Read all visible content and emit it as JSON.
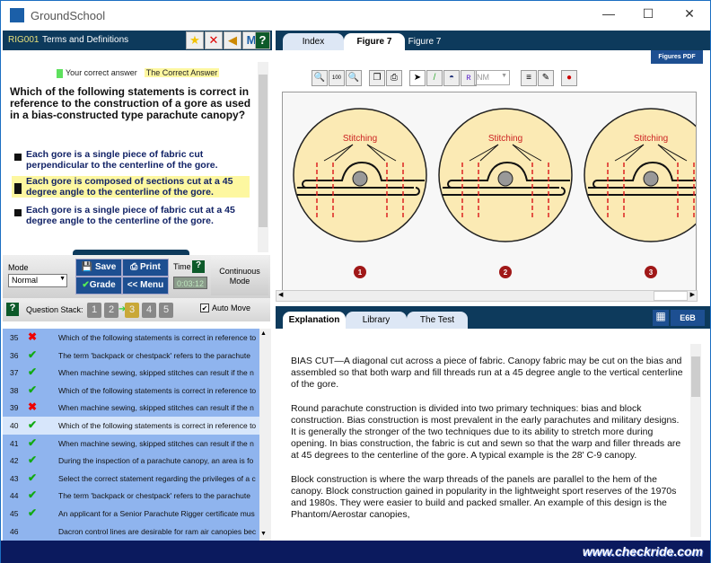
{
  "window": {
    "title": "GroundSchool",
    "minimize": "—",
    "maximize": "☐",
    "close": "✕"
  },
  "question_header": {
    "id": "RIG001",
    "category": "Terms and Definitions",
    "icons": [
      "star-icon",
      "cross-icon",
      "speaker-icon",
      "m-plus-icon",
      "help-icon"
    ]
  },
  "legend": {
    "your_correct": "Your correct answer",
    "correct": "The Correct Answer"
  },
  "question": {
    "text": "Which of the following statements is correct in reference to the construction of a gore as used in a bias-constructed type parachute canopy?",
    "answers": [
      {
        "text": "Each gore is a single piece of fabric cut perpendicular to the centerline of the gore.",
        "selected": false
      },
      {
        "text": "Each gore is composed of sections cut at a 45 degree angle to the centerline of the gore.",
        "selected": true
      },
      {
        "text": "Each gore is a single piece of fabric cut at a 45 degree angle to the centerline of the gore.",
        "selected": false
      }
    ]
  },
  "controls": {
    "mode_label": "Mode",
    "mode_value": "Normal",
    "save": "Save",
    "print": "Print",
    "grade": "Grade",
    "menu": "<< Menu",
    "time_label": "Time",
    "time_value": "0:03:12",
    "continuous": "Continuous Mode"
  },
  "stack": {
    "label": "Question Stack:",
    "items": [
      "1",
      "2",
      "3",
      "4",
      "5"
    ],
    "current": "3",
    "auto_move": "Auto Move",
    "auto_move_checked": true
  },
  "question_list": [
    {
      "n": "35",
      "status": "wrong",
      "text": "Which of the following statements is correct in reference to"
    },
    {
      "n": "36",
      "status": "right",
      "text": "The term 'backpack or chestpack' refers to the parachute"
    },
    {
      "n": "37",
      "status": "right",
      "text": "When machine sewing, skipped stitches can result if the n"
    },
    {
      "n": "38",
      "status": "right",
      "text": "Which of the following statements is correct in reference to"
    },
    {
      "n": "39",
      "status": "wrong",
      "text": "When machine sewing, skipped stitches can result if the n"
    },
    {
      "n": "40",
      "status": "right",
      "text": "Which of the following statements is correct in reference to",
      "current": true
    },
    {
      "n": "41",
      "status": "right",
      "text": "When machine sewing, skipped stitches can result if the n"
    },
    {
      "n": "42",
      "status": "right",
      "text": "During the inspection of a parachute canopy, an area is fo"
    },
    {
      "n": "43",
      "status": "right",
      "text": "Select the correct statement regarding the privileges of a c"
    },
    {
      "n": "44",
      "status": "right",
      "text": "The term 'backpack or chestpack' refers to the parachute"
    },
    {
      "n": "45",
      "status": "right",
      "text": "An applicant for a Senior Parachute Rigger certificate mus"
    },
    {
      "n": "46",
      "status": "none",
      "text": "Dacron control lines are desirable for ram air canopies bec"
    }
  ],
  "figure_tabs": [
    "Index",
    "Figure 7",
    "Figure 7"
  ],
  "figure": {
    "pdf_button": "Figures PDF",
    "units": "NM",
    "stitch_label": "Stitching",
    "numbers": [
      "1",
      "2",
      "3"
    ]
  },
  "bottom_tabs": [
    "Explanation",
    "Library",
    "The Test"
  ],
  "bottom_buttons": {
    "calculator": "calculator-icon",
    "e6b": "E6B"
  },
  "explanation": [
    "BIAS CUT—A diagonal cut across a piece of fabric. Canopy fabric may be cut on the bias and assembled so that both warp and fill threads run at a 45 degree angle to the vertical centerline of the gore.",
    "Round parachute construction is divided into two primary techniques: bias and block construction. Bias construction is most prevalent in the early parachutes and military designs. It is generally the stronger of the two techniques due to its ability to stretch more during opening. In bias construction, the fabric is cut and sewn so that the warp and filler threads are at 45 degrees to the centerline of the gore. A typical example is the 28' C-9 canopy.",
    "Block construction is where the warp threads of the panels are parallel to the hem of the canopy. Block construction gained in popularity in the lightweight sport reserves of the 1970s and 1980s. They were easier to build and packed smaller. An example of this design is the Phantom/Aerostar canopies,"
  ],
  "footer": {
    "url": "www.checkride.com"
  }
}
